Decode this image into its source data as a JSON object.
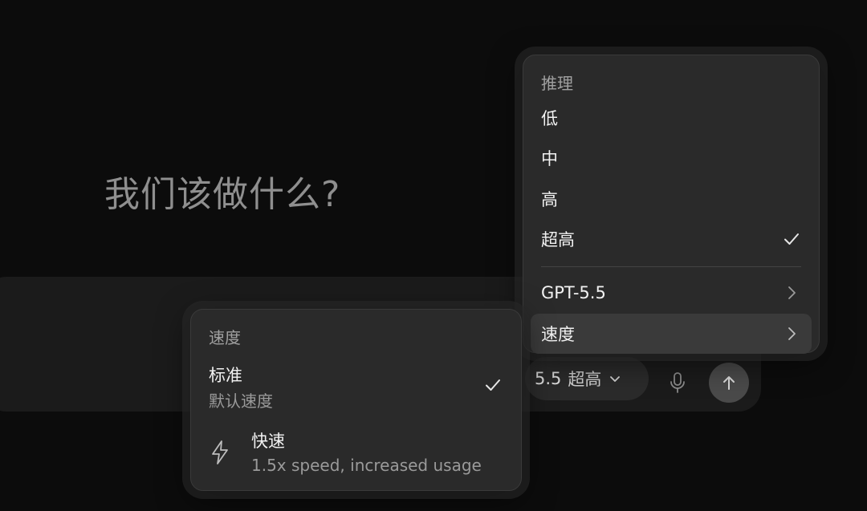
{
  "heading": "我们该做什么?",
  "composer": {
    "model_version": "5.5",
    "model_level": "超高",
    "mic_icon": "microphone-icon",
    "send_icon": "arrow-up-icon"
  },
  "reason_menu": {
    "title": "推理",
    "items": [
      {
        "label": "低"
      },
      {
        "label": "中"
      },
      {
        "label": "高"
      },
      {
        "label": "超高",
        "selected": true
      }
    ],
    "submenus": [
      {
        "label": "GPT-5.5"
      },
      {
        "label": "速度"
      }
    ]
  },
  "speed_menu": {
    "title": "速度",
    "options": [
      {
        "label": "标准",
        "description": "默认速度",
        "selected": true
      },
      {
        "label": "快速",
        "description": "1.5x speed, increased usage",
        "icon": "lightning-icon"
      }
    ]
  }
}
